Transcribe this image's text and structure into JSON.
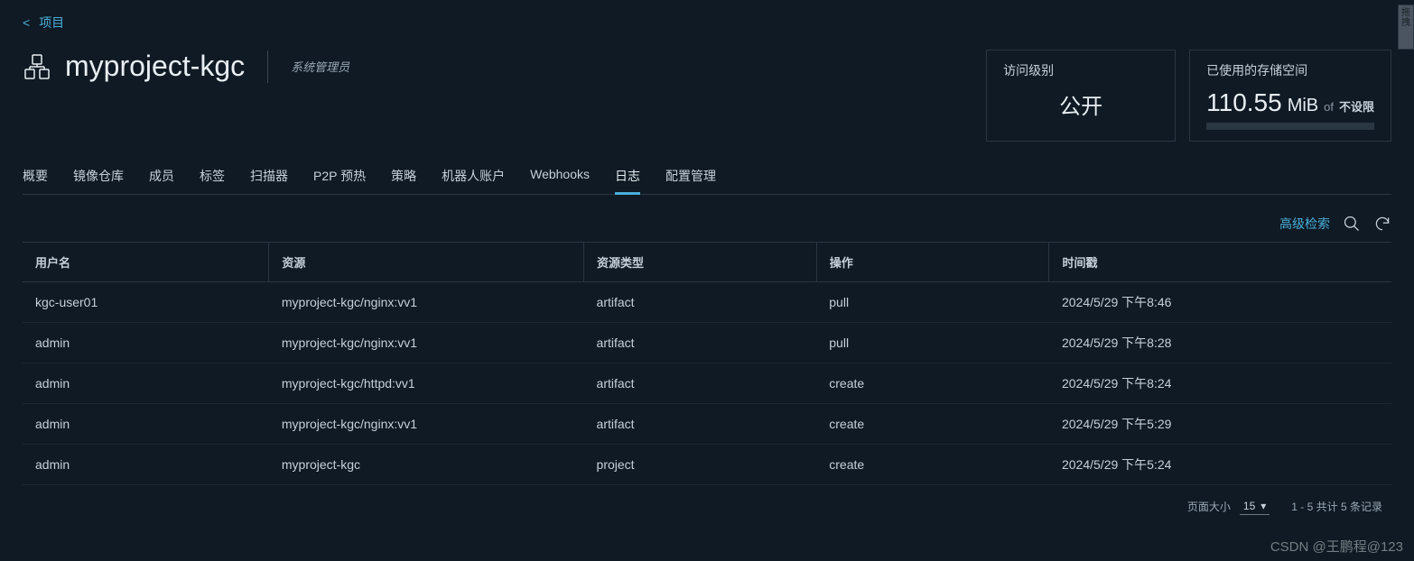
{
  "breadcrumb": {
    "back_label": "项目"
  },
  "header": {
    "title": "myproject-kgc",
    "role": "系统管理员"
  },
  "cards": {
    "access": {
      "label": "访问级别",
      "value": "公开"
    },
    "storage": {
      "label": "已使用的存储空间",
      "value": "110.55",
      "unit": "MiB",
      "of": "of",
      "limit": "不设限"
    }
  },
  "tabs": [
    {
      "label": "概要"
    },
    {
      "label": "镜像仓库"
    },
    {
      "label": "成员"
    },
    {
      "label": "标签"
    },
    {
      "label": "扫描器"
    },
    {
      "label": "P2P 预热"
    },
    {
      "label": "策略"
    },
    {
      "label": "机器人账户"
    },
    {
      "label": "Webhooks"
    },
    {
      "label": "日志",
      "active": true
    },
    {
      "label": "配置管理"
    }
  ],
  "toolbar": {
    "advanced_search": "高级检索"
  },
  "table": {
    "headers": [
      "用户名",
      "资源",
      "资源类型",
      "操作",
      "时间戳"
    ],
    "rows": [
      {
        "user": "kgc-user01",
        "resource": "myproject-kgc/nginx:vv1",
        "type": "artifact",
        "action": "pull",
        "time": "2024/5/29 下午8:46"
      },
      {
        "user": "admin",
        "resource": "myproject-kgc/nginx:vv1",
        "type": "artifact",
        "action": "pull",
        "time": "2024/5/29 下午8:28"
      },
      {
        "user": "admin",
        "resource": "myproject-kgc/httpd:vv1",
        "type": "artifact",
        "action": "create",
        "time": "2024/5/29 下午8:24"
      },
      {
        "user": "admin",
        "resource": "myproject-kgc/nginx:vv1",
        "type": "artifact",
        "action": "create",
        "time": "2024/5/29 下午5:29"
      },
      {
        "user": "admin",
        "resource": "myproject-kgc",
        "type": "project",
        "action": "create",
        "time": "2024/5/29 下午5:24"
      }
    ]
  },
  "pagination": {
    "page_size_label": "页面大小",
    "page_size_value": "15",
    "summary": "1 - 5 共计 5 条记录"
  },
  "watermark": "CSDN @王鹏程@123",
  "side_widget": "拖拽"
}
